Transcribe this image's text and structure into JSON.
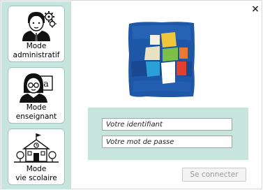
{
  "window": {
    "close_glyph": "×"
  },
  "modes": [
    {
      "label": "Mode\nadministratif",
      "icon": "admin-person-gears-icon"
    },
    {
      "label": "Mode\nenseignant",
      "icon": "teacher-board-icon"
    },
    {
      "label": "Mode\nvie scolaire",
      "icon": "school-building-icon"
    }
  ],
  "login": {
    "identifier_placeholder": "Votre identifiant",
    "password_placeholder": "Votre mot de passe",
    "connect_label": "Se connecter"
  },
  "colors": {
    "accent": "#c7e5dc",
    "card_border": "#9fc3b8"
  }
}
